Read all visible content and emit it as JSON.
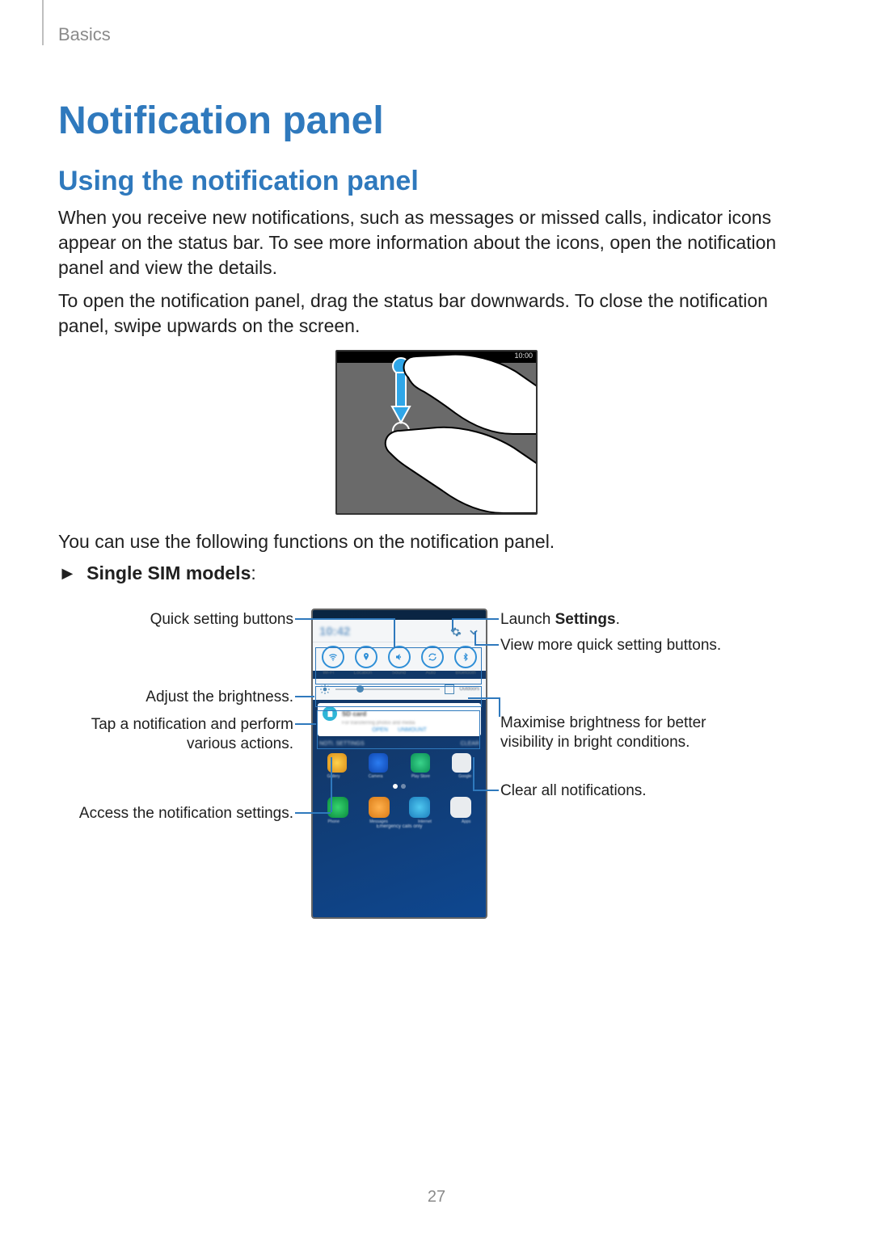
{
  "breadcrumb": "Basics",
  "title": "Notification panel",
  "subtitle": "Using the notification panel",
  "para1": "When you receive new notifications, such as messages or missed calls, indicator icons appear on the status bar. To see more information about the icons, open the notification panel and view the details.",
  "para2": "To open the notification panel, drag the status bar downwards. To close the notification panel, swipe upwards on the screen.",
  "figure1": {
    "status_time": "10:00"
  },
  "para3": "You can use the following functions on the notification panel.",
  "bullet_marker": "►",
  "bullet_label": "Single SIM models",
  "callouts": {
    "left": {
      "quick_settings": "Quick setting buttons",
      "brightness": "Adjust the brightness.",
      "tap_notif_line1": "Tap a notification and perform",
      "tap_notif_line2": "various actions.",
      "notif_settings": "Access the notification settings."
    },
    "right": {
      "launch_pre": "Launch ",
      "launch_bold": "Settings",
      "launch_post": ".",
      "more_qs": "View more quick setting buttons.",
      "max_bright_line1": "Maximise brightness for better",
      "max_bright_line2": "visibility in bright conditions.",
      "clear": "Clear all notifications."
    }
  },
  "pagenum": "27"
}
